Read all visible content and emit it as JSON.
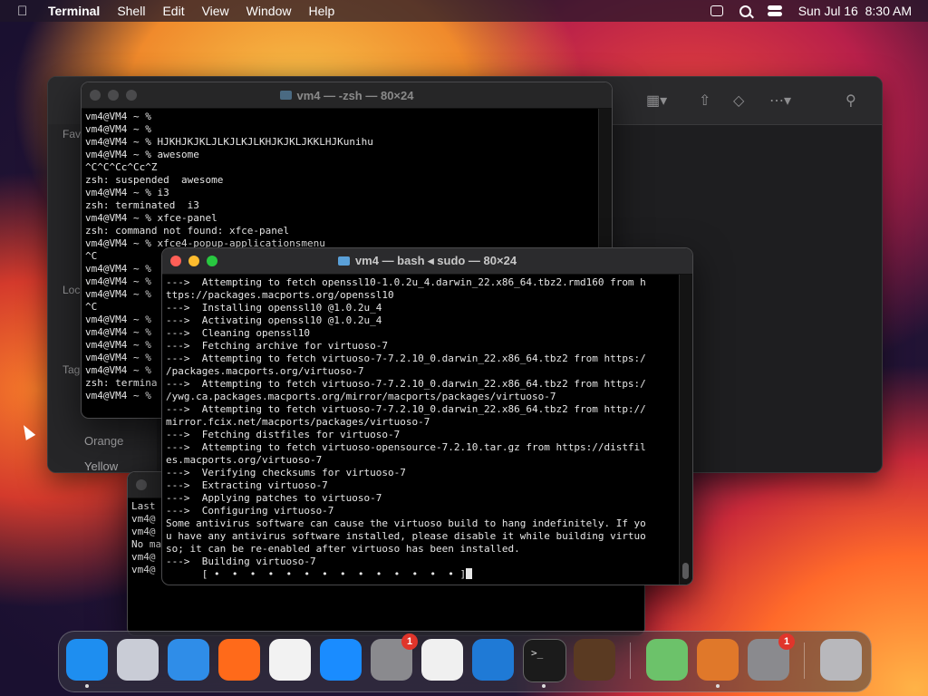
{
  "menubar": {
    "app_name": "Terminal",
    "menus": [
      "Shell",
      "Edit",
      "View",
      "Window",
      "Help"
    ],
    "clock": "Sun Jul 16  8:30 AM",
    "icons": [
      "apple-icon",
      "screen-mirroring-icon",
      "spotlight-search-icon",
      "control-center-icon"
    ]
  },
  "finder": {
    "sidebar_labels": [
      "Fav",
      "Loc",
      "Tag"
    ],
    "tags": [
      "Orange",
      "Yellow"
    ]
  },
  "term_back": {
    "title": "vm4 — -zsh — 80×24",
    "lines": [
      "vm4@VM4 ~ %",
      "vm4@VM4 ~ %",
      "vm4@VM4 ~ % HJKHJKJKLJLKJLKJLKHJKJKLJKKLHJKunihu",
      "vm4@VM4 ~ % awesome",
      "^C^C^Cc^Cc^Z",
      "zsh: suspended  awesome",
      "vm4@VM4 ~ % i3",
      "zsh: terminated  i3",
      "vm4@VM4 ~ % xfce-panel",
      "zsh: command not found: xfce-panel",
      "vm4@VM4 ~ % xfce4-popup-applicationsmenu",
      "^C",
      "vm4@VM4 ~ %",
      "vm4@VM4 ~ %",
      "vm4@VM4 ~ %",
      "^C",
      "vm4@VM4 ~ %",
      "vm4@VM4 ~ %",
      "vm4@VM4 ~ %",
      "vm4@VM4 ~ %",
      "vm4@VM4 ~ %",
      "zsh: termina",
      "vm4@VM4 ~ %"
    ]
  },
  "term_small": {
    "lines": [
      "Last",
      "vm4@",
      "vm4@",
      "No ma",
      "vm4@",
      "vm4@"
    ]
  },
  "term_front": {
    "title": "vm4 — bash ◂ sudo — 80×24",
    "lines": [
      "--->  Attempting to fetch openssl10-1.0.2u_4.darwin_22.x86_64.tbz2.rmd160 from h",
      "ttps://packages.macports.org/openssl10",
      "--->  Installing openssl10 @1.0.2u_4",
      "--->  Activating openssl10 @1.0.2u_4",
      "--->  Cleaning openssl10",
      "--->  Fetching archive for virtuoso-7",
      "--->  Attempting to fetch virtuoso-7-7.2.10_0.darwin_22.x86_64.tbz2 from https:/",
      "/packages.macports.org/virtuoso-7",
      "--->  Attempting to fetch virtuoso-7-7.2.10_0.darwin_22.x86_64.tbz2 from https:/",
      "/ywg.ca.packages.macports.org/mirror/macports/packages/virtuoso-7",
      "--->  Attempting to fetch virtuoso-7-7.2.10_0.darwin_22.x86_64.tbz2 from http://",
      "mirror.fcix.net/macports/packages/virtuoso-7",
      "--->  Fetching distfiles for virtuoso-7",
      "--->  Attempting to fetch virtuoso-opensource-7.2.10.tar.gz from https://distfil",
      "es.macports.org/virtuoso-7",
      "--->  Verifying checksums for virtuoso-7",
      "--->  Extracting virtuoso-7",
      "--->  Applying patches to virtuoso-7",
      "--->  Configuring virtuoso-7",
      "Some antivirus software can cause the virtuoso build to hang indefinitely. If yo",
      "u have any antivirus software installed, please disable it while building virtuo",
      "so; it can be re-enabled after virtuoso has been installed.",
      "--->  Building virtuoso-7",
      "      [ •  •  •  •  •  •  •  •  •  •  •  •  •  • ]"
    ]
  },
  "dock": {
    "items": [
      {
        "name": "finder",
        "color": "#1e8ef0",
        "running": true
      },
      {
        "name": "launchpad",
        "color": "#c9ccd6",
        "running": false
      },
      {
        "name": "safari",
        "color": "#2f8de8",
        "running": false
      },
      {
        "name": "firefox",
        "color": "#ff6a1a",
        "running": false
      },
      {
        "name": "chrome",
        "color": "#f2f2f2",
        "running": false
      },
      {
        "name": "app-store",
        "color": "#1a8cff",
        "running": false
      },
      {
        "name": "system-settings",
        "color": "#8a8a8e",
        "running": false,
        "badge": "1"
      },
      {
        "name": "textedit",
        "color": "#f0f0f0",
        "running": false
      },
      {
        "name": "vscode",
        "color": "#1f7ad6",
        "running": false
      },
      {
        "name": "terminal",
        "color": "#1b1b1b",
        "running": true
      },
      {
        "name": "garageband",
        "color": "#5a3a22",
        "running": false
      },
      {
        "name": "maps",
        "color": "#6cc26a",
        "running": false
      },
      {
        "name": "x11",
        "color": "#e0782a",
        "running": true
      },
      {
        "name": "system-settings-2",
        "color": "#8a8a8e",
        "running": false,
        "badge": "1"
      },
      {
        "name": "trash",
        "color": "#b8b8bc",
        "running": false
      }
    ]
  }
}
